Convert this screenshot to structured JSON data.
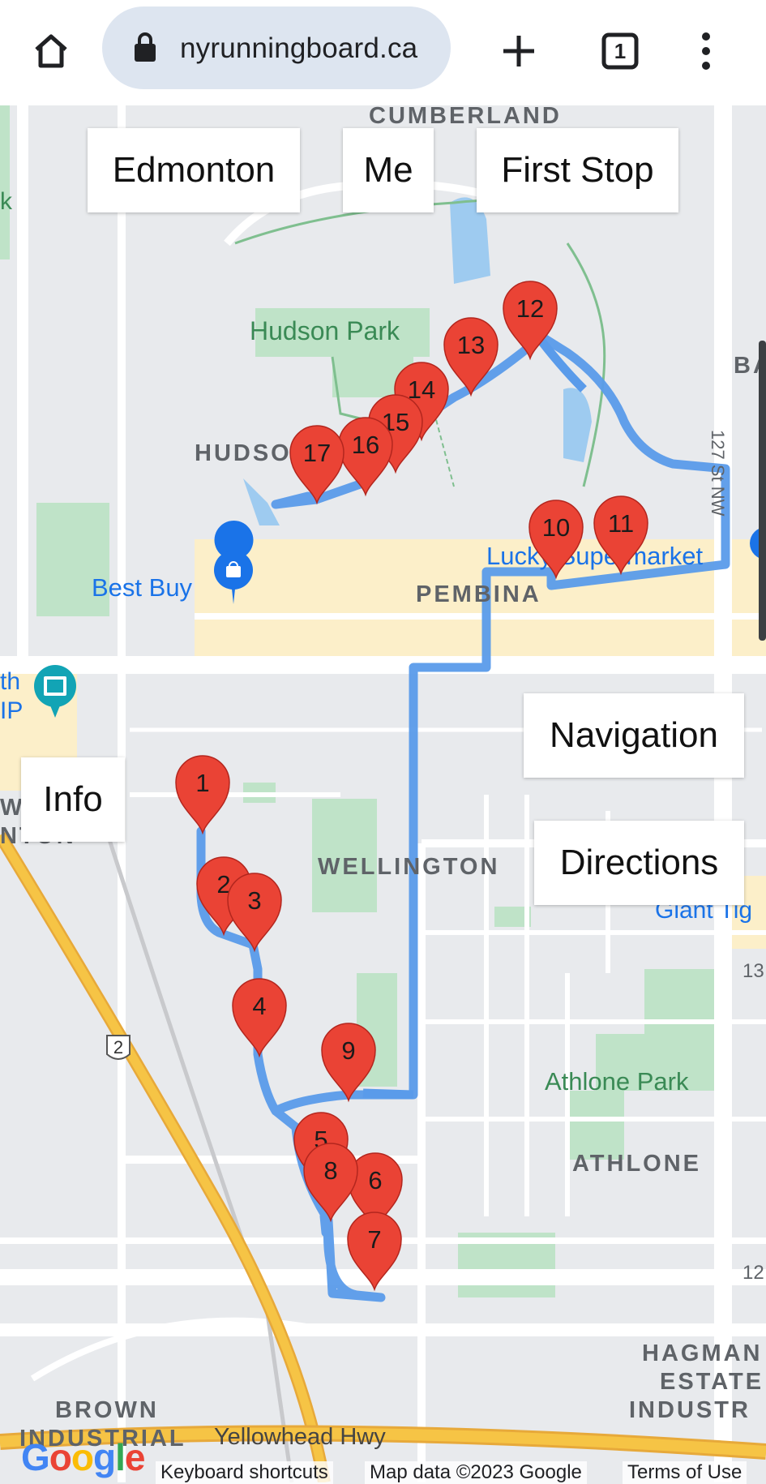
{
  "browser": {
    "url": "nyrunningboard.ca",
    "tab_count": "1",
    "icons": [
      "home-icon",
      "lock-icon",
      "new-tab-icon",
      "tab-switcher-icon",
      "menu-icon"
    ]
  },
  "map_buttons": {
    "edmonton": "Edmonton",
    "me": "Me",
    "first_stop": "First Stop",
    "navigation": "Navigation",
    "info": "Info",
    "directions": "Directions"
  },
  "map_labels": {
    "cumberland": "CUMBERLAND",
    "hudson_park": "Hudson Park",
    "hudson": "HUDSO",
    "best_buy": "Best Buy",
    "pembina": "PEMBINA",
    "lucky_supermarket": "Lucky Supermarket",
    "st_127": "127 St NW",
    "wellington": "WELLINGTON",
    "giant_tiger": "Giant Tig",
    "athlone_park": "Athlone Park",
    "athlone": "ATHLONE",
    "hagmann_1": "HAGMAN",
    "hagmann_2": "ESTATE",
    "hagmann_3": "INDUSTR",
    "brown_industrial_1": "BROWN",
    "brown_industrial_2": "INDUSTRIAL",
    "yellowhead": "Yellowhead Hwy",
    "highway_2": "2",
    "ba": "BA",
    "edge_k": "k",
    "edge_th": "th",
    "edge_ip": "IP",
    "edge_w": "W",
    "edge_nton": "NTON",
    "edge_13": "13",
    "edge_12": "12"
  },
  "markers": [
    "1",
    "2",
    "3",
    "4",
    "5",
    "6",
    "7",
    "8",
    "9",
    "10",
    "11",
    "12",
    "13",
    "14",
    "15",
    "16",
    "17"
  ],
  "footer": {
    "google": "Google",
    "keyboard_shortcuts": "Keyboard shortcuts",
    "map_data": "Map data ©2023 Google",
    "terms": "Terms of Use"
  },
  "colors": {
    "route": "#5a9bea",
    "marker": "#ea4335",
    "highway": "#f6c445",
    "park": "#bfe3c8",
    "water": "#9ecbf0",
    "commercial": "#fcefc9"
  }
}
